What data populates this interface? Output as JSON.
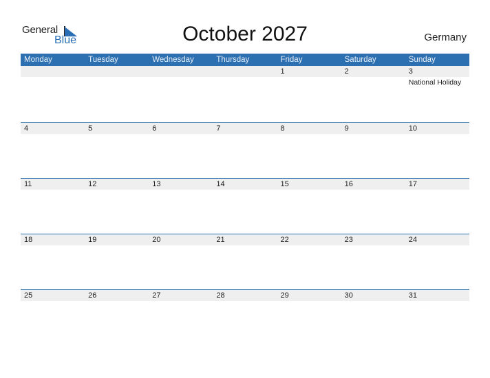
{
  "logo": {
    "general": "General",
    "blue": "Blue"
  },
  "title": "October 2027",
  "country": "Germany",
  "weekdays": [
    "Monday",
    "Tuesday",
    "Wednesday",
    "Thursday",
    "Friday",
    "Saturday",
    "Sunday"
  ],
  "weeks": [
    [
      {
        "d": ""
      },
      {
        "d": ""
      },
      {
        "d": ""
      },
      {
        "d": ""
      },
      {
        "d": "1"
      },
      {
        "d": "2"
      },
      {
        "d": "3",
        "event": "National Holiday"
      }
    ],
    [
      {
        "d": "4"
      },
      {
        "d": "5"
      },
      {
        "d": "6"
      },
      {
        "d": "7"
      },
      {
        "d": "8"
      },
      {
        "d": "9"
      },
      {
        "d": "10"
      }
    ],
    [
      {
        "d": "11"
      },
      {
        "d": "12"
      },
      {
        "d": "13"
      },
      {
        "d": "14"
      },
      {
        "d": "15"
      },
      {
        "d": "16"
      },
      {
        "d": "17"
      }
    ],
    [
      {
        "d": "18"
      },
      {
        "d": "19"
      },
      {
        "d": "20"
      },
      {
        "d": "21"
      },
      {
        "d": "22"
      },
      {
        "d": "23"
      },
      {
        "d": "24"
      }
    ],
    [
      {
        "d": "25"
      },
      {
        "d": "26"
      },
      {
        "d": "27"
      },
      {
        "d": "28"
      },
      {
        "d": "29"
      },
      {
        "d": "30"
      },
      {
        "d": "31"
      }
    ]
  ]
}
